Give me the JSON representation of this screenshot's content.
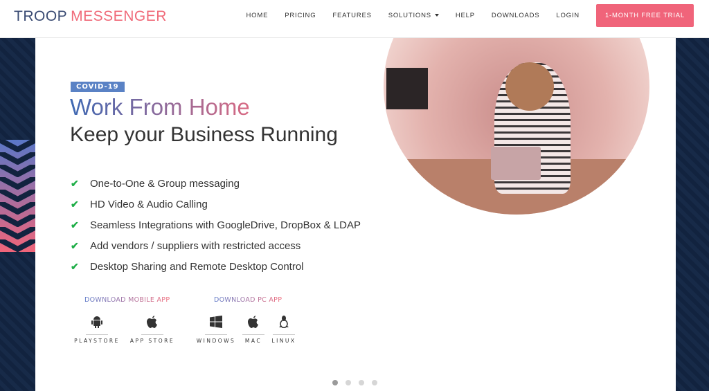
{
  "header": {
    "logo_part1": "TROOP",
    "logo_part2": "MESSENGER",
    "nav": [
      "HOME",
      "PRICING",
      "FEATURES",
      "SOLUTIONS",
      "HELP",
      "DOWNLOADS",
      "LOGIN"
    ],
    "cta": "1-MONTH FREE TRIAL"
  },
  "hero": {
    "badge": "COVID-19",
    "title": "Work From Home",
    "subtitle": "Keep your Business Running",
    "features": [
      "One-to-One & Group messaging",
      "HD Video & Audio Calling",
      "Seamless Integrations with GoogleDrive, DropBox & LDAP",
      "Add vendors / suppliers with restricted access",
      "Desktop Sharing and Remote Desktop Control"
    ],
    "mobile_title": "DOWNLOAD MOBILE APP",
    "pc_title": "DOWNLOAD PC APP",
    "mobile": [
      {
        "label": "PLAYSTORE",
        "icon": "android-icon"
      },
      {
        "label": "APP STORE",
        "icon": "apple-icon"
      }
    ],
    "pc": [
      {
        "label": "WINDOWS",
        "icon": "windows-icon"
      },
      {
        "label": "MAC",
        "icon": "apple-icon"
      },
      {
        "label": "LINUX",
        "icon": "linux-icon"
      }
    ]
  },
  "carousel": {
    "slides": 4,
    "active": 1
  },
  "colors": {
    "brand_navy": "#3b4c74",
    "brand_pink": "#f06a79",
    "check": "#1fae48"
  }
}
